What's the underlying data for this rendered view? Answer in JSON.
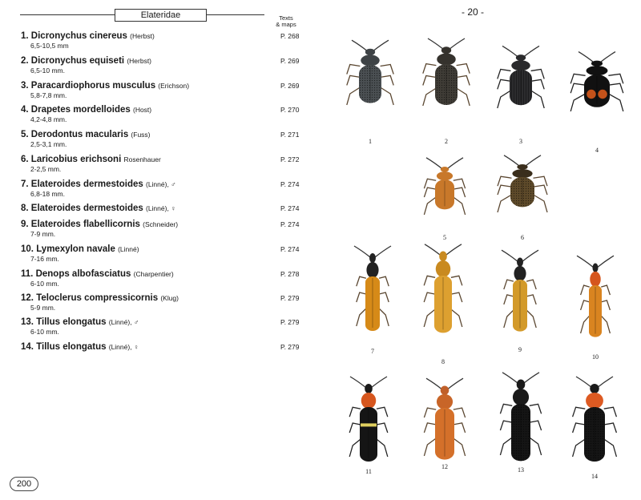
{
  "left_page": {
    "family": "Elateridae",
    "col_header": "Texts\n& maps",
    "page_number": "200",
    "entries": [
      {
        "num": "1.",
        "name": "Dicronychus cinereus",
        "author": "(Herbst)",
        "size": "6,5-10,5 mm",
        "page": "P. 268"
      },
      {
        "num": "2.",
        "name": "Dicronychus equiseti",
        "author": "(Herbst)",
        "size": "6,5-10 mm.",
        "page": "P. 269"
      },
      {
        "num": "3.",
        "name": "Paracardiophorus musculus",
        "author": "(Erichson)",
        "size": "5,8-7,8 mm.",
        "page": "P. 269"
      },
      {
        "num": "4.",
        "name": "Drapetes mordelloides",
        "author": "(Host)",
        "size": "4,2-4,8 mm.",
        "page": "P. 270"
      },
      {
        "num": "5.",
        "name": "Derodontus macularis",
        "author": "(Fuss)",
        "size": "2,5-3,1 mm.",
        "page": "P. 271"
      },
      {
        "num": "6.",
        "name": "Laricobius erichsoni",
        "author": "Rosenhauer",
        "size": "2-2,5 mm.",
        "page": "P. 272"
      },
      {
        "num": "7.",
        "name": "Elateroides dermestoides",
        "author": "(Linné), ♂",
        "size": "6,8-18 mm.",
        "page": "P. 274"
      },
      {
        "num": "8.",
        "name": "Elateroides dermestoides",
        "author": "(Linné), ♀",
        "size": "",
        "page": "P. 274"
      },
      {
        "num": "9.",
        "name": "Elateroides flabellicornis",
        "author": "(Schneider)",
        "size": "7-9 mm.",
        "page": "P. 274"
      },
      {
        "num": "10.",
        "name": "Lymexylon navale",
        "author": "(Linné)",
        "size": "7-16 mm.",
        "page": "P. 274"
      },
      {
        "num": "11.",
        "name": "Denops albofasciatus",
        "author": "(Charpentier)",
        "size": "6-10 mm.",
        "page": "P. 278"
      },
      {
        "num": "12.",
        "name": "Teloclerus compressicornis",
        "author": "(Klug)",
        "size": "5-9 mm.",
        "page": "P. 279"
      },
      {
        "num": "13.",
        "name": "Tillus elongatus",
        "author": "(Linné), ♂",
        "size": "6-10 mm.",
        "page": "P. 279"
      },
      {
        "num": "14.",
        "name": "Tillus elongatus",
        "author": "(Linné), ♀",
        "size": "",
        "page": "P. 279"
      }
    ]
  },
  "right_page": {
    "page_header": "- 20 -",
    "figure_labels": [
      "1",
      "2",
      "3",
      "4",
      "5",
      "6",
      "7",
      "8",
      "9",
      "10",
      "11",
      "12",
      "13",
      "14"
    ]
  }
}
